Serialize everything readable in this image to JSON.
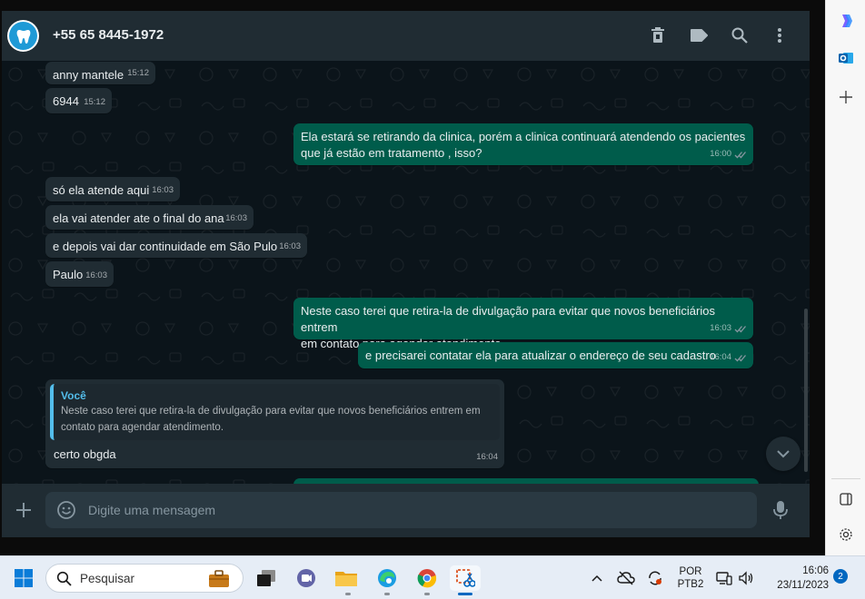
{
  "header": {
    "contact_name": "+55 65 8445-1972",
    "icons": [
      "delete-icon",
      "label-icon",
      "search-icon",
      "menu-icon"
    ]
  },
  "messages": [
    {
      "type": "in",
      "text": "anny mantele",
      "time": "15:12"
    },
    {
      "type": "in",
      "text": "6944",
      "time": "15:12"
    },
    {
      "type": "out",
      "lines": [
        "Ela estará se retirando da clinica, porém a clinica continuará atendendo os pacientes",
        "que já estão em tratamento , isso?"
      ],
      "time": "16:00"
    },
    {
      "type": "in",
      "text": "só ela atende aqui",
      "time": "16:03"
    },
    {
      "type": "in",
      "text": "ela vai atender ate o final do ana",
      "time": "16:03"
    },
    {
      "type": "in",
      "text": "e depois vai dar continuidade  em São Pulo",
      "time": "16:03"
    },
    {
      "type": "in",
      "text": "Paulo",
      "time": "16:03"
    },
    {
      "type": "out",
      "lines": [
        "Neste caso terei que retira-la de divulgação para evitar que novos beneficiários entrem",
        "em contato para agendar atendimento."
      ],
      "time": "16:03"
    },
    {
      "type": "out",
      "text": "e precisarei contatar ela para atualizar o endereço de seu cadastro",
      "time": "16:04"
    },
    {
      "type": "in_reply",
      "quote_author": "Você",
      "quote_lines": [
        "Neste caso terei que retira-la de divulgação para evitar que novos beneficiários entrem em",
        "contato para agendar atendimento."
      ],
      "text": "certo obgda",
      "time": "16:04"
    }
  ],
  "composer": {
    "placeholder": "Digite uma mensagem"
  },
  "taskbar": {
    "search_placeholder": "Pesquisar",
    "language": "POR",
    "layout": "PTB2",
    "time": "16:06",
    "date": "23/11/2023",
    "notifications": "2"
  },
  "colors": {
    "incoming": "#202c33",
    "outgoing": "#005c4b",
    "quote_accent": "#53bdeb",
    "background": "#0b141a"
  }
}
